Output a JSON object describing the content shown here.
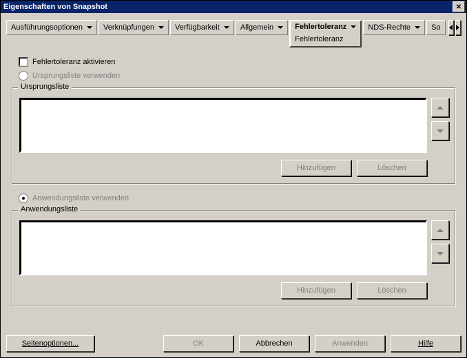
{
  "window": {
    "title": "Eigenschaften von Snapshot",
    "close_glyph": "✕"
  },
  "tabs": {
    "items": [
      {
        "label": "Ausführungsoptionen"
      },
      {
        "label": "Verknüpfungen"
      },
      {
        "label": "Verfügbarkeit"
      },
      {
        "label": "Allgemein"
      },
      {
        "label": "Fehlertoleranz",
        "sub": "Fehlertoleranz",
        "active": true
      },
      {
        "label": "NDS-Rechte"
      },
      {
        "label": "So"
      }
    ]
  },
  "controls": {
    "activate_checkbox": "Fehlertoleranz aktivieren",
    "radio_source": "Ursprungsliste verwenden",
    "radio_app": "Anwendungsliste verwenden"
  },
  "group_source": {
    "legend": "Ursprungsliste",
    "add": "Hinzufügen",
    "delete": "Löschen"
  },
  "group_app": {
    "legend": "Anwendungsliste",
    "add": "Hinzufügen",
    "delete": "Löschen"
  },
  "footer": {
    "page_options": "Seitenoptionen...",
    "ok": "OK",
    "cancel": "Abbrechen",
    "apply": "Anwenden",
    "help": "Hilfe"
  }
}
